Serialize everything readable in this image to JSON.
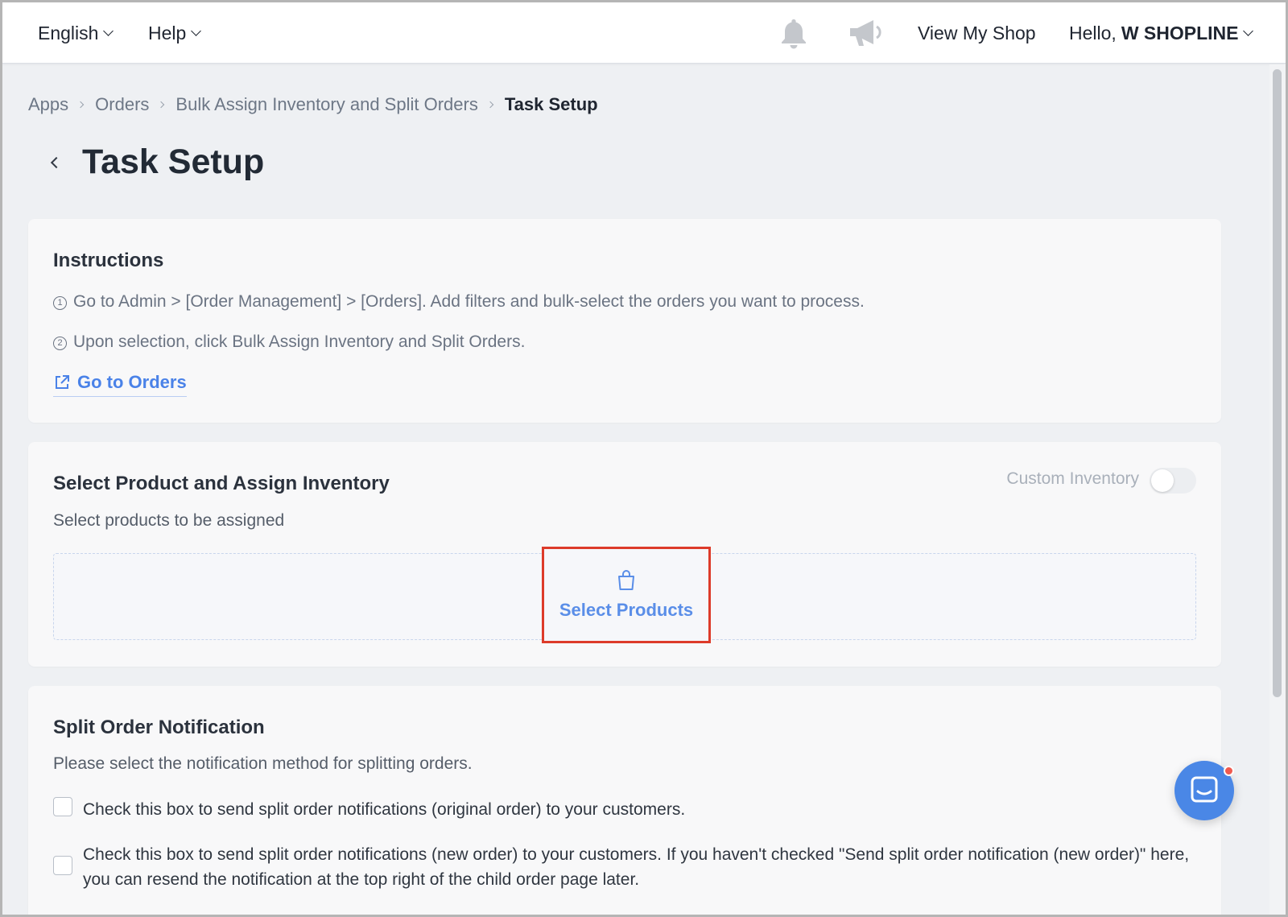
{
  "topbar": {
    "language": "English",
    "help": "Help",
    "bell_icon": "bell-icon",
    "announcement_icon": "megaphone-icon",
    "view_shop": "View My Shop",
    "hello_prefix": "Hello,",
    "user_name": "W SHOPLINE"
  },
  "breadcrumb": {
    "items": [
      "Apps",
      "Orders",
      "Bulk Assign Inventory and Split Orders"
    ],
    "current": "Task Setup"
  },
  "page": {
    "title": "Task Setup"
  },
  "instructions": {
    "title": "Instructions",
    "step1_num": "1",
    "step1": "Go to Admin > [Order Management] > [Orders]. Add filters and bulk-select the orders you want to process.",
    "step2_num": "2",
    "step2": "Upon selection, click Bulk Assign Inventory and Split Orders.",
    "link": "Go to Orders"
  },
  "assign": {
    "title": "Select Product and Assign Inventory",
    "subtitle": "Select products to be assigned",
    "toggle_label": "Custom Inventory",
    "toggle_on": false,
    "button": "Select Products"
  },
  "notification": {
    "title": "Split Order Notification",
    "subtitle": "Please select the notification method for splitting orders.",
    "option1": "Check this box to send split order notifications (original order) to your customers.",
    "option2": "Check this box to send split order notifications (new order) to your customers. If you haven't checked \"Send split order notification (new order)\" here, you can resend the notification at the top right of the child order page later."
  },
  "colors": {
    "accent": "#4a82e8",
    "highlight": "#dd3b2a",
    "chat": "#4a87e6",
    "badge": "#f05a4f"
  }
}
